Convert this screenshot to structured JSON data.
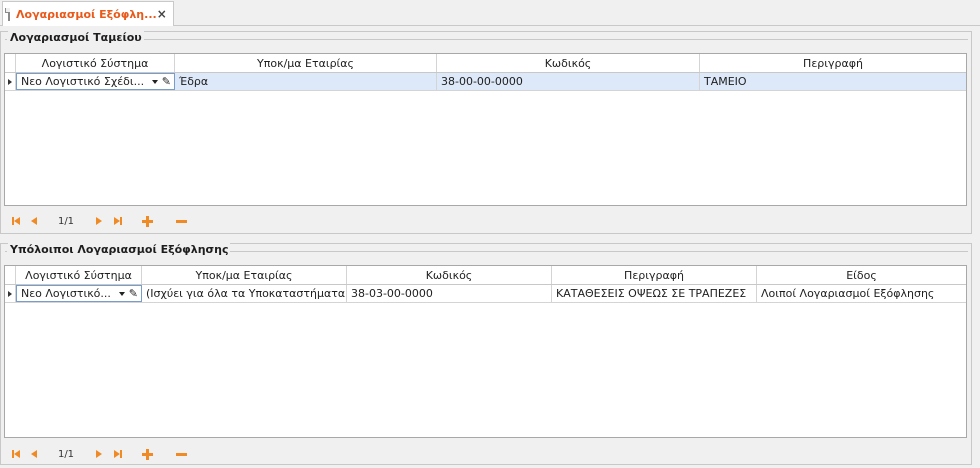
{
  "tab": {
    "title": "Λογαριασμοί Εξόφλη...",
    "close": "×"
  },
  "cash_accounts": {
    "caption": "Λογαριασμοί Ταμείου",
    "columns": [
      "Λογιστικό Σύστημα",
      "Υποκ/μα Εταιρίας",
      "Κωδικός",
      "Περιγραφή"
    ],
    "rows": [
      {
        "system": "Νεο Λογιστικό Σχέδι...",
        "branch": "Έδρα",
        "code": "38-00-00-0000",
        "description": "ΤΑΜΕΙΟ"
      }
    ],
    "pager": "1/1"
  },
  "other_accounts": {
    "caption": "Υπόλοιποι Λογαριασμοί Εξόφλησης",
    "columns": [
      "Λογιστικό Σύστημα",
      "Υποκ/μα Εταιρίας",
      "Κωδικός",
      "Περιγραφή",
      "Είδος"
    ],
    "rows": [
      {
        "system": "Νεο Λογιστικό...",
        "branch": "(Ισχύει για όλα τα Υποκαταστήματα)",
        "code": "38-03-00-0000",
        "description": "ΚΑΤΑΘΕΣΕΙΣ ΟΨΕΩΣ ΣΕ ΤΡΑΠΕΖΕΣ",
        "type": "Λοιποί Λογαριασμοί Εξόφλησης"
      }
    ],
    "pager": "1/1"
  },
  "icons": {
    "tab_doc": "document-icon",
    "first": "first-record-icon",
    "prev": "previous-record-icon",
    "next": "next-record-icon",
    "last": "last-record-icon",
    "add": "plus-icon",
    "remove": "minus-icon",
    "dropdown": "chevron-down-icon",
    "edit": "pencil-icon"
  },
  "colors": {
    "accent": "#e8591a",
    "nav": "#f08a24",
    "selected_row": "#dde8f8"
  }
}
